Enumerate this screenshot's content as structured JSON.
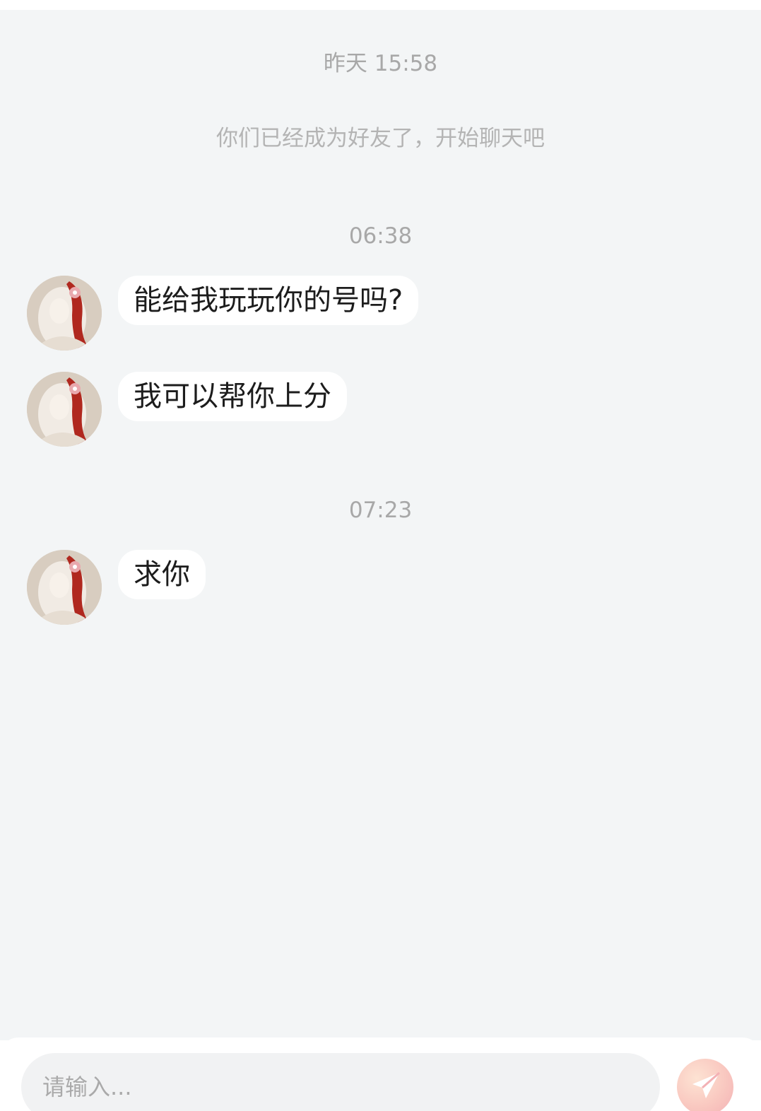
{
  "chat": {
    "time_divider_1": "昨天 15:58",
    "system_notice": "你们已经成为好友了，开始聊天吧",
    "time_divider_2": "06:38",
    "time_divider_3": "07:23",
    "messages": [
      {
        "text": "能给我玩玩你的号吗?"
      },
      {
        "text": "我可以帮你上分"
      },
      {
        "text": "求你"
      }
    ]
  },
  "input": {
    "placeholder": "请输入..."
  },
  "colors": {
    "chat_background": "#f3f5f6",
    "bubble_background": "#ffffff",
    "timestamp_text": "#a8a8a8",
    "send_button": "#f7c3bd"
  },
  "icons": {
    "send": "paper-plane-icon",
    "avatar": "avatar-image"
  }
}
